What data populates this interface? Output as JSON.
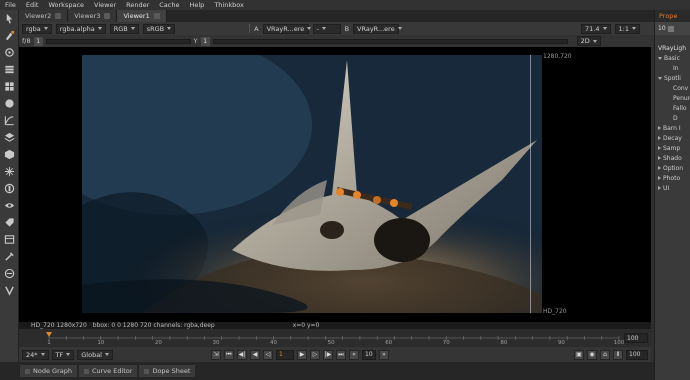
{
  "menu": [
    "File",
    "Edit",
    "Workspace",
    "Viewer",
    "Render",
    "Cache",
    "Help",
    "Thinkbox"
  ],
  "viewer_tabs": [
    {
      "label": "Viewer2"
    },
    {
      "label": "Viewer3"
    },
    {
      "label": "Viewer1",
      "active": true
    }
  ],
  "row1": {
    "channels": "rgba",
    "alpha": "rgba.alpha",
    "colorspace": "RGB",
    "lut": "sRGB",
    "input_a_label": "A",
    "input_a": "VRayR...ere",
    "compare": "-",
    "input_b_label": "B",
    "input_b": "VRayR...ere",
    "zoom": "71.4",
    "ratio": "1:1"
  },
  "row2": {
    "fstop": "f/8",
    "gain_value": "1",
    "y_label": "Y",
    "gamma_value": "1",
    "view_mode": "2D"
  },
  "viewer": {
    "corner_top_right": "1280,720",
    "corner_bottom_right": "HD_720",
    "info_format": "HD_720 1280x720",
    "info_bbox": "bbox: 0 0 1280 720 channels: rgba,deep",
    "info_coords": "x=0 y=0"
  },
  "timeline": {
    "ticks": [
      "1",
      "10",
      "20",
      "30",
      "40",
      "50",
      "60",
      "70",
      "80",
      "90",
      "100"
    ],
    "current_frame_value": 1,
    "end_field": "100"
  },
  "controls": {
    "fps": "24*",
    "tf": "TF",
    "scope": "Global",
    "frame": "1",
    "increment": "10",
    "end": "100"
  },
  "bottom_tabs": [
    "Node Graph",
    "Curve Editor",
    "Dope Sheet"
  ],
  "properties": {
    "header": "Prope",
    "count": "10",
    "node_name": "VRayLigh",
    "items": [
      {
        "label": "Basic",
        "expand": "down"
      },
      {
        "label": "In",
        "expand": "none"
      },
      {
        "label": "Spotli",
        "expand": "down"
      },
      {
        "label": "Conv",
        "expand": "none"
      },
      {
        "label": "Penumbra",
        "expand": "none"
      },
      {
        "label": "Fallo",
        "expand": "none"
      },
      {
        "label": "D",
        "expand": "none"
      },
      {
        "label": "Barn I",
        "expand": "right"
      },
      {
        "label": "Decay",
        "expand": "right"
      },
      {
        "label": "Samp",
        "expand": "right"
      },
      {
        "label": "Shado",
        "expand": "right"
      },
      {
        "label": "Option",
        "expand": "right"
      },
      {
        "label": "Photo",
        "expand": "right"
      },
      {
        "label": "UI",
        "expand": "right"
      }
    ]
  },
  "colors": {
    "accent_orange": "#e6842a",
    "timeline_red": "#c0392b",
    "background": "#2b2b2b"
  },
  "toolbar_icons": [
    "pointer-icon",
    "paint-icon",
    "draw-icon",
    "layers-icon",
    "grid-icon",
    "sphere-icon",
    "curve-icon",
    "stack-icon",
    "cube-icon",
    "particle-icon",
    "deep-icon",
    "eye-icon",
    "tag-icon",
    "channel-icon",
    "toolset-icon",
    "other-icon",
    "vray-icon"
  ]
}
